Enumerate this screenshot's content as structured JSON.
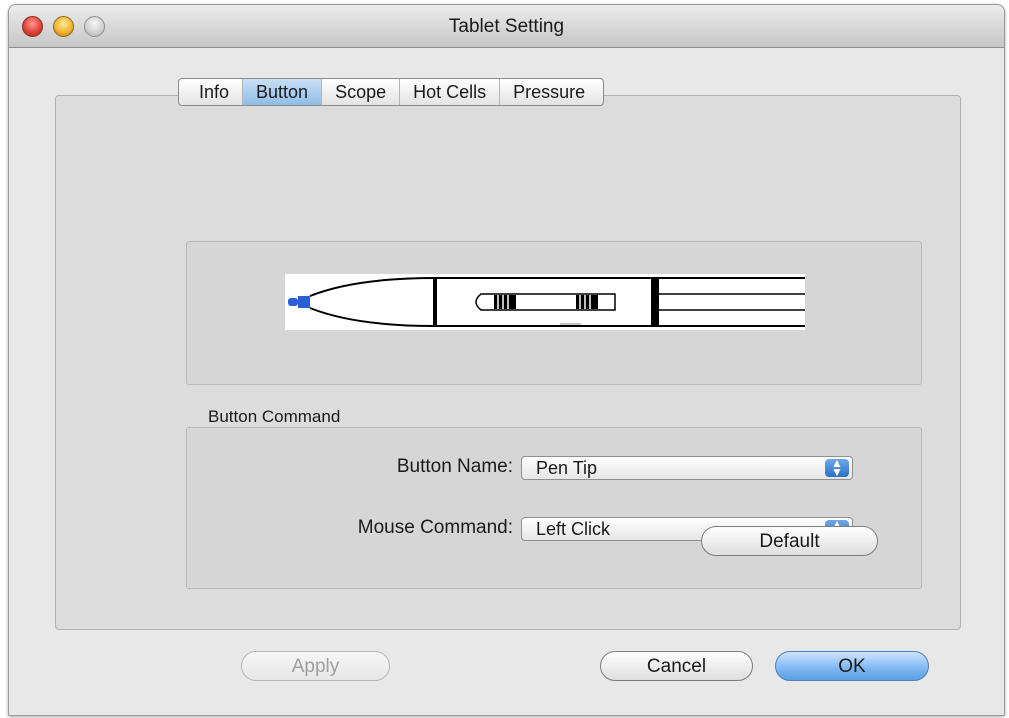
{
  "window": {
    "title": "Tablet Setting"
  },
  "tabs": [
    {
      "label": "Info",
      "active": false
    },
    {
      "label": "Button",
      "active": true
    },
    {
      "label": "Scope",
      "active": false
    },
    {
      "label": "Hot Cells",
      "active": false
    },
    {
      "label": "Pressure",
      "active": false
    }
  ],
  "preview": {
    "icon": "pen-diagram",
    "tip_color": "#2b5fd9"
  },
  "button_command": {
    "group_label": "Button Command",
    "button_name_label": "Button Name:",
    "button_name_value": "Pen Tip",
    "mouse_command_label": "Mouse Command:",
    "mouse_command_value": "Left Click",
    "default_label": "Default"
  },
  "footer": {
    "apply_label": "Apply",
    "cancel_label": "Cancel",
    "ok_label": "OK"
  },
  "colors": {
    "accent": "#6aaae9",
    "selected_tab": "#9fc7ee"
  }
}
